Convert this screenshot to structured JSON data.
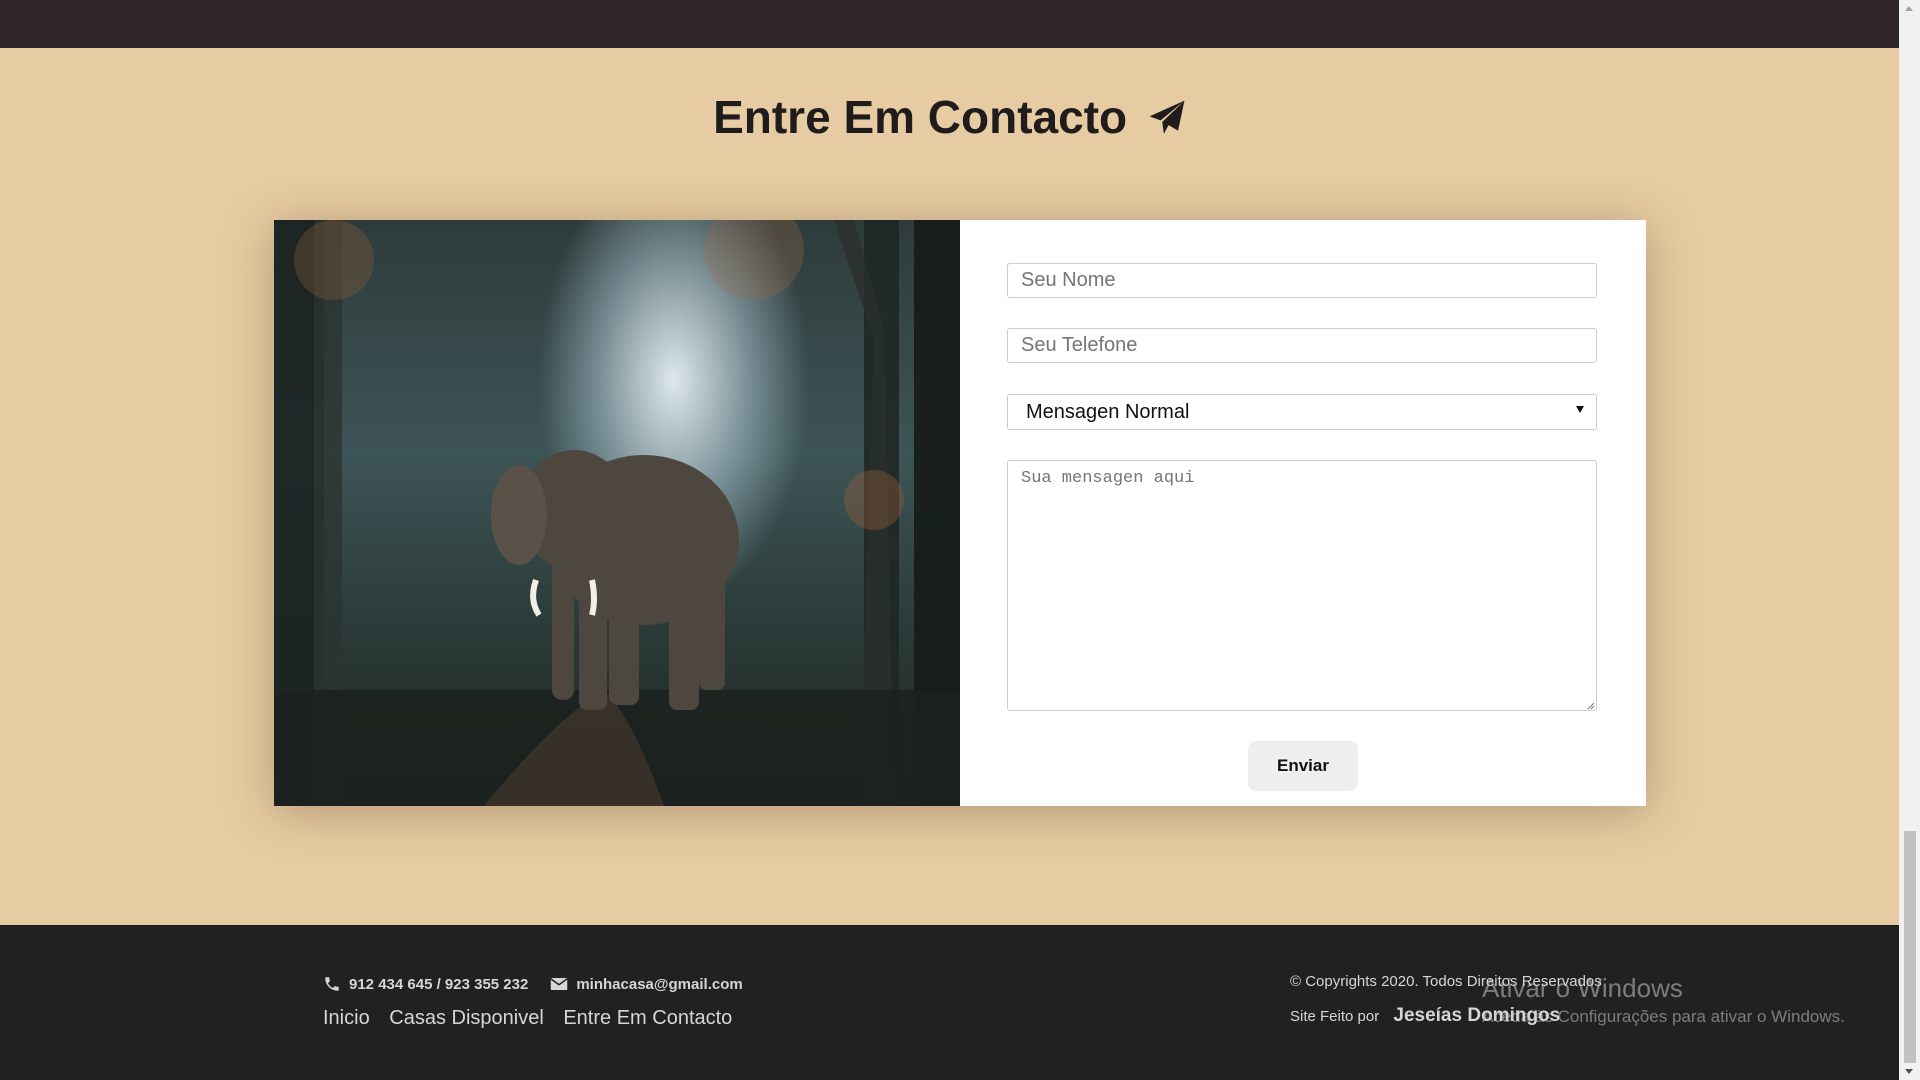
{
  "section": {
    "title": "Entre Em Contacto"
  },
  "form": {
    "name_placeholder": "Seu Nome",
    "phone_placeholder": "Seu Telefone",
    "message_type_selected": "Mensagen Normal",
    "message_placeholder": "Sua mensagen aqui",
    "submit_label": "Enviar"
  },
  "footer": {
    "phones": "912 434 645 / 923 355 232",
    "email": "minhacasa@gmail.com",
    "nav": [
      "Inicio",
      "Casas Disponivel",
      "Entre Em Contacto"
    ],
    "copyright": "© Copyrights 2020. Todos Direitos Reservados",
    "made_by_label": "Site Feito por",
    "author": "Jeseías Domingos"
  },
  "os_watermark": {
    "title": "Ativar o Windows",
    "subtitle": "Aceda às Configurações para ativar o Windows."
  },
  "icons": {
    "title_icon": "paper-plane-icon",
    "phone_icon": "phone-icon",
    "email_icon": "envelope-icon"
  },
  "colors": {
    "page_bg": "#e6cba3",
    "dark_bar": "#2d252a",
    "footer_bg": "#212022",
    "title_text": "#201c1c"
  }
}
